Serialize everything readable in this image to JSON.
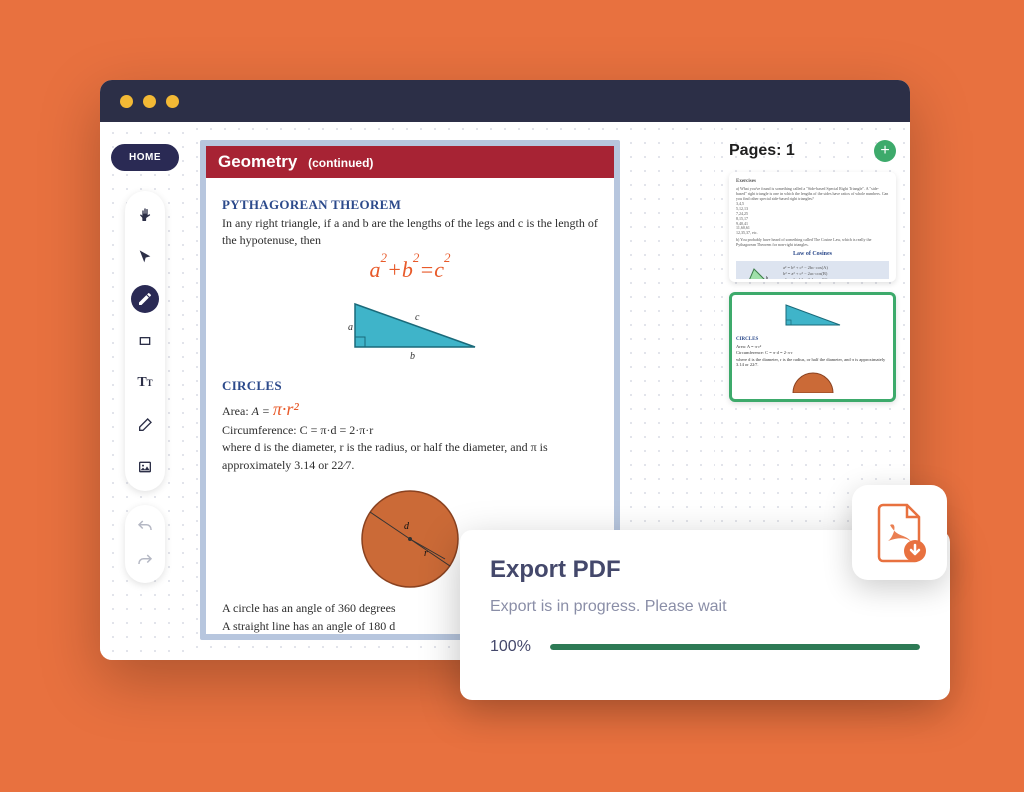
{
  "nav": {
    "home": "HOME"
  },
  "pages": {
    "label": "Pages:",
    "count": "1"
  },
  "document": {
    "header_title": "Geometry",
    "header_cont": "(continued)",
    "pythag": {
      "title": "PYTHAGOREAN THEOREM",
      "body": "In any right triangle, if a and b are the lengths of the legs and c is the length of the hypotenuse, then",
      "formula_a": "a",
      "formula_b": "b",
      "formula_c": "c",
      "formula_plus": "+",
      "formula_eq": "=",
      "tri_a": "a",
      "tri_b": "b",
      "tri_c": "c"
    },
    "circles": {
      "title": "CIRCLES",
      "area_label": "Area:",
      "area_eq": "A =",
      "area_hand": "π·r²",
      "circ": "Circumference: C = π·d = 2·π·r",
      "where": "where d is the diameter, r is the radius, or half the diameter, and π is approximately 3.14 or ",
      "frac": "22⁄7",
      "period": ".",
      "d_label": "d",
      "r_label": "r",
      "line1": "A circle has an angle of 360 degrees",
      "line2": "A straight line has an angle of 180 d"
    }
  },
  "thumb2": {
    "title": "CIRCLES",
    "area": "Area: A = π·r²",
    "circ": "Circumference: C = π·d = 2·π·r",
    "where": "where d is the diameter, r is the radius, or half the diameter, and π is approximately 3.14 or 22⁄7."
  },
  "thumb1": {
    "sec": "Exercises",
    "law": "Law of Cosines"
  },
  "export": {
    "title": "Export PDF",
    "message": "Export is in progress. Please wait",
    "percent": "100%",
    "fill": 100
  }
}
